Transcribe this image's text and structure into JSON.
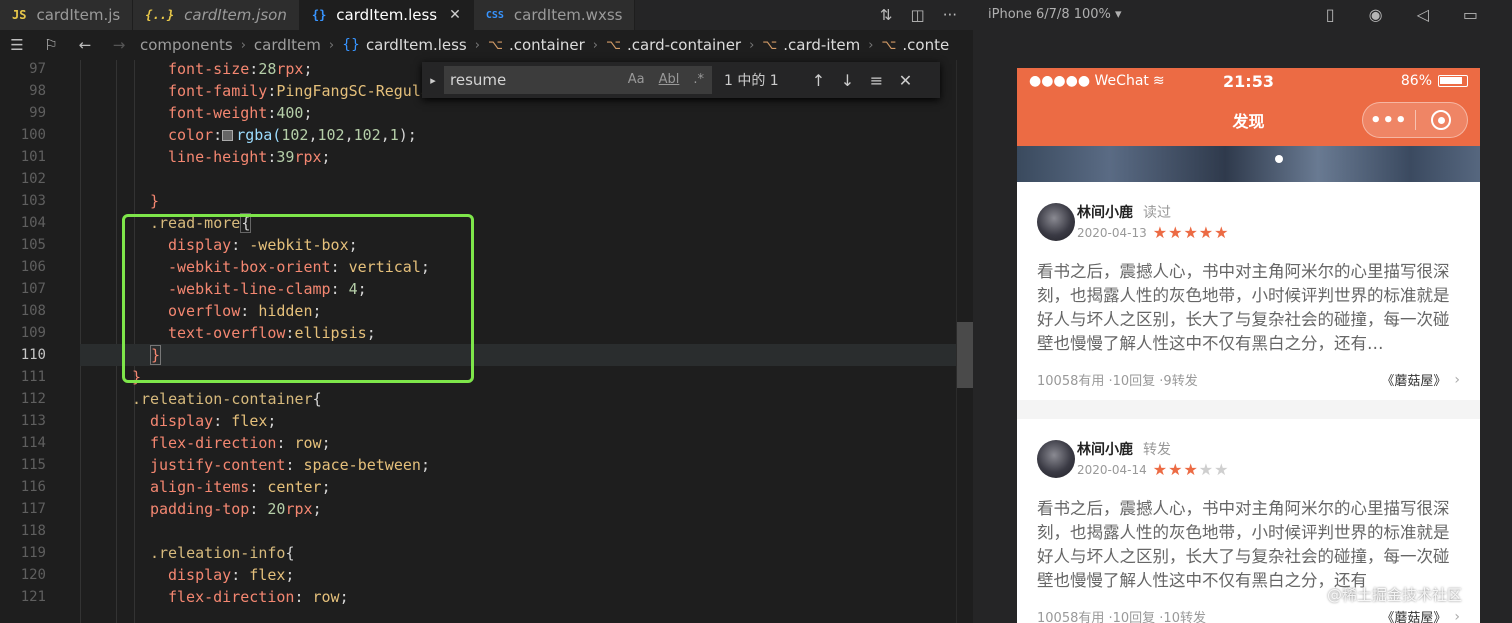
{
  "tabs": [
    {
      "icon": "JS",
      "label": "cardItem.js"
    },
    {
      "icon": "{..}",
      "label": "cardItem.json"
    },
    {
      "icon": "{}",
      "label": "cardItem.less"
    },
    {
      "icon": "CSS",
      "label": "cardItem.wxss"
    }
  ],
  "breadcrumb": {
    "parts": [
      "components",
      "cardItem",
      "cardItem.less",
      ".container",
      ".card-container",
      ".card-item",
      ".conte"
    ]
  },
  "find": {
    "query": "resume",
    "opts": [
      "Aa",
      "Abl",
      ".*"
    ],
    "count": "1 中的 1"
  },
  "code": {
    "line_numbers": [
      "97",
      "98",
      "99",
      "100",
      "101",
      "102",
      "103",
      "104",
      "105",
      "106",
      "107",
      "108",
      "109",
      "110",
      "111",
      "112",
      "113",
      "114",
      "115",
      "116",
      "117",
      "118",
      "119",
      "120",
      "121"
    ],
    "l97": [
      "font-size",
      ":",
      "28",
      "rpx",
      ";"
    ],
    "l98": [
      "font-family",
      ":",
      "PingFangSC-Regula"
    ],
    "l99": [
      "font-weight",
      ":",
      "400",
      ";"
    ],
    "l100": [
      "color",
      ":",
      "rgba(",
      "102",
      ",",
      "102",
      ",",
      "102",
      ",",
      "1",
      ");"
    ],
    "l101": [
      "line-height",
      ":",
      "39",
      "rpx",
      ";"
    ],
    "l103": "}",
    "l104": [
      ".read-more",
      "{"
    ],
    "l105": [
      "display",
      ": ",
      "-webkit-box",
      ";"
    ],
    "l106": [
      "-webkit-box-orient",
      ": ",
      "vertical",
      ";"
    ],
    "l107": [
      "-webkit-line-clamp",
      ": ",
      "4",
      ";"
    ],
    "l108": [
      "overflow",
      ": ",
      "hidden",
      ";"
    ],
    "l109": [
      "text-overflow",
      ":",
      "ellipsis",
      ";"
    ],
    "l110": "}",
    "l111": "}",
    "l112": [
      ".releation-container",
      "{"
    ],
    "l113": [
      "display",
      ": ",
      "flex",
      ";"
    ],
    "l114": [
      "flex-direction",
      ": ",
      "row",
      ";"
    ],
    "l115": [
      "justify-content",
      ": ",
      "space-between",
      ";"
    ],
    "l116": [
      "align-items",
      ": ",
      "center",
      ";"
    ],
    "l117": [
      "padding-top",
      ": ",
      "20",
      "rpx",
      ";"
    ],
    "l119": [
      ".releation-info",
      "{"
    ],
    "l120": [
      "display",
      ": ",
      "flex",
      ";"
    ],
    "l121": [
      "flex-direction",
      ": ",
      "row",
      ";"
    ]
  },
  "simulator": {
    "device": "iPhone 6/7/8 100% ▾",
    "status_left": "●●●●● WeChat",
    "time": "21:53",
    "battery": "86%",
    "nav_title": "发现",
    "capsule_dots": "•••",
    "watermark": "@稀土掘金技术社区",
    "accent_color": "#ec6b44"
  },
  "cards": [
    {
      "name": "林间小鹿",
      "action": "读过",
      "date": "2020-04-13",
      "stars": [
        1,
        1,
        1,
        1,
        1
      ],
      "text": "看书之后，震撼人心，书中对主角阿米尔的心里描写很深刻，也揭露人性的灰色地带，小时候评判世界的标准就是好人与坏人之区别，长大了与复杂社会的碰撞，每一次碰壁也慢慢了解人性这中不仅有黑白之分，还有…",
      "stats": "10058有用 ·10回复 ·9转发",
      "source": "《蘑菇屋》"
    },
    {
      "name": "林间小鹿",
      "action": "转发",
      "date": "2020-04-14",
      "stars": [
        1,
        1,
        1,
        0,
        0
      ],
      "text": "看书之后，震撼人心，书中对主角阿米尔的心里描写很深刻，也揭露人性的灰色地带，小时候评判世界的标准就是好人与坏人之区别，长大了与复杂社会的碰撞，每一次碰壁也慢慢了解人性这中不仅有黑白之分，还有",
      "stats": "10058有用 ·10回复 ·10转发",
      "source": "《蘑菇屋》"
    }
  ]
}
